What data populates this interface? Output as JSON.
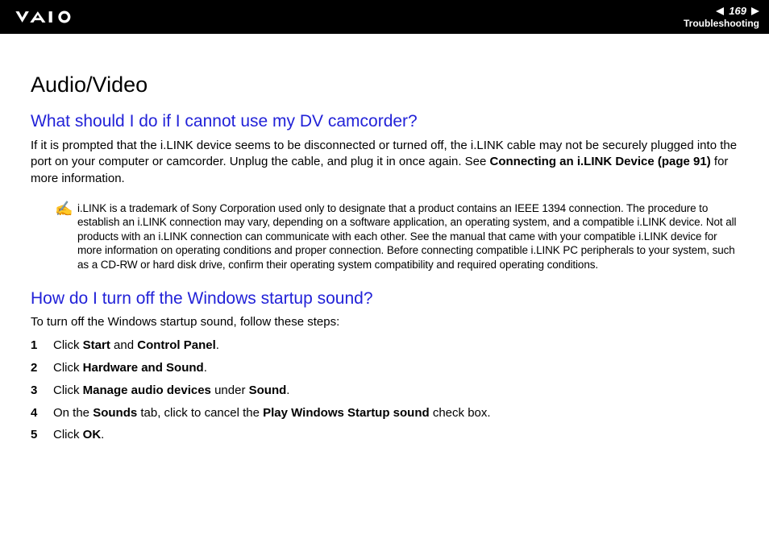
{
  "header": {
    "page_number": "169",
    "section": "Troubleshooting"
  },
  "title": "Audio/Video",
  "q1": {
    "heading": "What should I do if I cannot use my DV camcorder?",
    "body_pre": "If it is prompted that the i.LINK device seems to be disconnected or turned off, the i.LINK cable may not be securely plugged into the port on your computer or camcorder. Unplug the cable, and plug it in once again. See ",
    "body_link": "Connecting an i.LINK Device (page 91)",
    "body_post": " for more information.",
    "note_icon": "✍",
    "note": "i.LINK is a trademark of Sony Corporation used only to designate that a product contains an IEEE 1394 connection. The procedure to establish an i.LINK connection may vary, depending on a software application, an operating system, and a compatible i.LINK device. Not all products with an i.LINK connection can communicate with each other. See the manual that came with your compatible i.LINK device for more information on operating conditions and proper connection. Before connecting compatible i.LINK PC peripherals to your system, such as a CD-RW or hard disk drive, confirm their operating system compatibility and required operating conditions."
  },
  "q2": {
    "heading": "How do I turn off the Windows startup sound?",
    "intro": "To turn off the Windows startup sound, follow these steps:",
    "steps": [
      {
        "pre": "Click ",
        "b1": "Start",
        "mid": " and ",
        "b2": "Control Panel",
        "post": "."
      },
      {
        "pre": "Click ",
        "b1": "Hardware and Sound",
        "post": "."
      },
      {
        "pre": "Click ",
        "b1": "Manage audio devices",
        "mid": " under ",
        "b2": "Sound",
        "post": "."
      },
      {
        "pre": "On the ",
        "b1": "Sounds",
        "mid": " tab, click to cancel the ",
        "b2": "Play Windows Startup sound",
        "post": " check box."
      },
      {
        "pre": "Click ",
        "b1": "OK",
        "post": "."
      }
    ]
  }
}
